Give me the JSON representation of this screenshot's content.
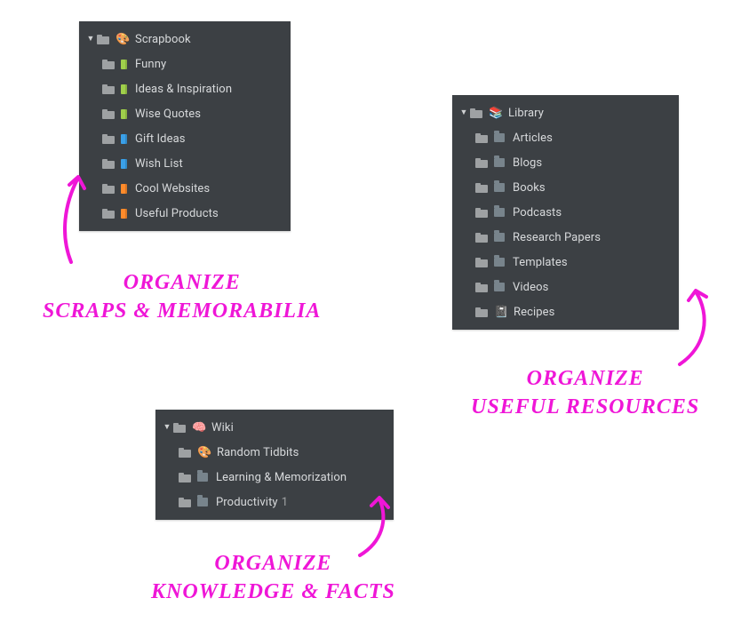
{
  "panels": {
    "scrapbook": {
      "head_emoji": "🎨",
      "head_label": "Scrapbook",
      "items": [
        {
          "icon": "book",
          "color": "#a0d04b",
          "label": "Funny"
        },
        {
          "icon": "book",
          "color": "#a0d04b",
          "label": "Ideas & Inspiration"
        },
        {
          "icon": "book",
          "color": "#a0d04b",
          "label": "Wise Quotes"
        },
        {
          "icon": "book",
          "color": "#3aa0e8",
          "label": "Gift Ideas"
        },
        {
          "icon": "book",
          "color": "#3aa0e8",
          "label": "Wish List"
        },
        {
          "icon": "book",
          "color": "#ff8b2b",
          "label": "Cool Websites"
        },
        {
          "icon": "book",
          "color": "#ff8b2b",
          "label": "Useful Products"
        }
      ]
    },
    "library": {
      "head_emoji": "📚",
      "head_label": "Library",
      "items": [
        {
          "icon": "filefolder",
          "label": "Articles"
        },
        {
          "icon": "filefolder",
          "label": "Blogs"
        },
        {
          "icon": "filefolder",
          "label": "Books"
        },
        {
          "icon": "filefolder",
          "label": "Podcasts"
        },
        {
          "icon": "filefolder",
          "label": "Research Papers"
        },
        {
          "icon": "filefolder",
          "label": "Templates"
        },
        {
          "icon": "filefolder",
          "label": "Videos"
        },
        {
          "icon": "emoji",
          "emoji": "📓",
          "label": "Recipes"
        }
      ]
    },
    "wiki": {
      "head_emoji": "🧠",
      "head_label": "Wiki",
      "items": [
        {
          "icon": "emoji",
          "emoji": "🎨",
          "label": "Random Tidbits"
        },
        {
          "icon": "filefolder",
          "label": "Learning & Memorization"
        },
        {
          "icon": "filefolder",
          "label": "Productivity",
          "count": "1"
        }
      ]
    }
  },
  "annotations": {
    "scrapbook_line1": "organize",
    "scrapbook_line2": "scraps & memorabilia",
    "library_line1": "organize",
    "library_line2": "useful resources",
    "wiki_line1": "organize",
    "wiki_line2": "knowledge & facts"
  }
}
